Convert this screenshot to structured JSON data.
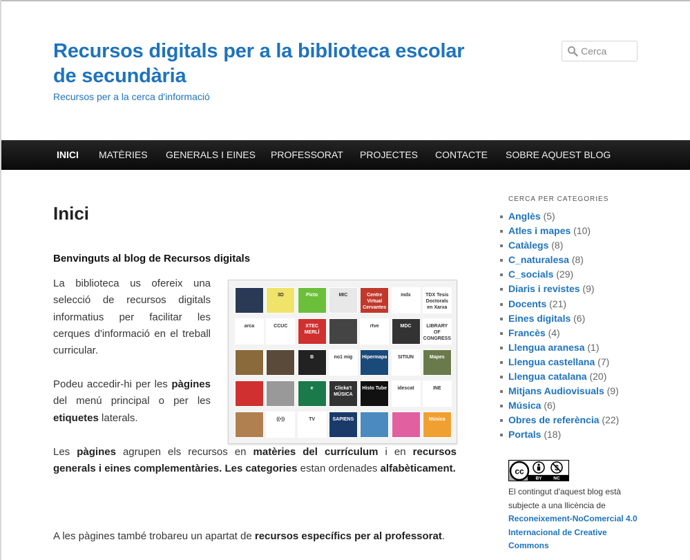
{
  "header": {
    "title": "Recursos digitals per a la biblioteca escolar de secundària",
    "tagline": "Recursos per a la cerca d'informació"
  },
  "search": {
    "placeholder": "Cerca",
    "icon": "search-icon"
  },
  "nav": [
    {
      "label": "INICI",
      "active": true
    },
    {
      "label": "MATÈRIES"
    },
    {
      "label": "GENERALS I EINES"
    },
    {
      "label": "PROFESSORAT"
    },
    {
      "label": "PROJECTES"
    },
    {
      "label": "CONTACTE"
    },
    {
      "label": "SOBRE AQUEST BLOG"
    }
  ],
  "page": {
    "title": "Inici",
    "welcome": "Benvinguts al blog de Recursos digitals",
    "p1": "La biblioteca us ofereix una selecció de recursos digitals informatius per facilitar les cerques d'informació en el treball curricular.",
    "p2_a": "Podeu accedir-hi per les ",
    "p2_b": "pàgines",
    "p2_c": " del menú principal o per les ",
    "p2_d": "etiquetes",
    "p2_e": " laterals.",
    "p3_a": "Les ",
    "p3_b": "pàgines",
    "p3_c": " agrupen els recursos en ",
    "p3_d": "matèries del currículum",
    "p3_e": " i en ",
    "p3_f": "recursos generals i eines complementàries. Les categories",
    "p3_g": " estan ordenades ",
    "p3_h": "alfabèticament.",
    "p4_a": "A les pàgines també trobareu un apartat de ",
    "p4_b": "recursos específics per al professorat",
    "p4_c": "."
  },
  "mosaic": {
    "tiles": [
      {
        "text": "",
        "bg": "#2a3a55"
      },
      {
        "text": "3D",
        "bg": "#f0e36a"
      },
      {
        "text": "Picto",
        "bg": "#6cbf3a"
      },
      {
        "text": "MIC",
        "bg": "#e8e8e8"
      },
      {
        "text": "Centre Virtual Cervantes",
        "bg": "#c0392b"
      },
      {
        "text": "mdx",
        "bg": "#ffffff"
      },
      {
        "text": "TDX Tesis Doctorals en Xarxa",
        "bg": "#ffffff"
      },
      {
        "text": "arca",
        "bg": "#ffffff"
      },
      {
        "text": "CCUC",
        "bg": "#ffffff"
      },
      {
        "text": "XTEC MERLÍ",
        "bg": "#d03030"
      },
      {
        "text": "",
        "bg": "#444444"
      },
      {
        "text": "rtve",
        "bg": "#ffffff"
      },
      {
        "text": "MDC",
        "bg": "#333333"
      },
      {
        "text": "LIBRARY OF CONGRESS",
        "bg": "#ffffff"
      },
      {
        "text": "",
        "bg": "#8a6a3a"
      },
      {
        "text": "",
        "bg": "#5a4a3a"
      },
      {
        "text": "B",
        "bg": "#222222"
      },
      {
        "text": "no1 mig",
        "bg": "#ffffff"
      },
      {
        "text": "Hipermapa",
        "bg": "#1a4a7a"
      },
      {
        "text": "SITIUN",
        "bg": "#ffffff"
      },
      {
        "text": "Mapes",
        "bg": "#6a7a4a"
      },
      {
        "text": "",
        "bg": "#d03030"
      },
      {
        "text": "",
        "bg": "#999999"
      },
      {
        "text": "e",
        "bg": "#1a7a4a"
      },
      {
        "text": "Clicka't MÚSICA",
        "bg": "#333333"
      },
      {
        "text": "Histo Tube",
        "bg": "#111111"
      },
      {
        "text": "idescat",
        "bg": "#ffffff"
      },
      {
        "text": "INE",
        "bg": "#ffffff"
      },
      {
        "text": "",
        "bg": "#b08050"
      },
      {
        "text": "((•))",
        "bg": "#ffffff"
      },
      {
        "text": "TV",
        "bg": "#ffffff"
      },
      {
        "text": "SAPIENS",
        "bg": "#1a3a6a"
      },
      {
        "text": "",
        "bg": "#4a8ac0"
      },
      {
        "text": "",
        "bg": "#e060a0"
      },
      {
        "text": "Música",
        "bg": "#f0a030"
      }
    ]
  },
  "sidebar": {
    "title": "CERCA PER CATEGORIES",
    "categories": [
      {
        "name": "Anglès",
        "count": "(5)"
      },
      {
        "name": "Atles i mapes",
        "count": "(10)"
      },
      {
        "name": "Catàlegs",
        "count": "(8)"
      },
      {
        "name": "C_naturalesa",
        "count": "(8)"
      },
      {
        "name": "C_socials",
        "count": "(29)"
      },
      {
        "name": "Diaris i revistes",
        "count": "(9)"
      },
      {
        "name": "Docents",
        "count": "(21)"
      },
      {
        "name": "Eines digitals",
        "count": "(6)"
      },
      {
        "name": "Francès",
        "count": "(4)"
      },
      {
        "name": "Llengua aranesa",
        "count": "(1)"
      },
      {
        "name": "Llengua castellana",
        "count": "(7)"
      },
      {
        "name": "Llengua catalana",
        "count": "(20)"
      },
      {
        "name": "Mitjans Audiovisuals",
        "count": "(9)"
      },
      {
        "name": "Música",
        "count": "(6)"
      },
      {
        "name": "Obres de referència",
        "count": "(22)"
      },
      {
        "name": "Portals",
        "count": "(18)"
      }
    ],
    "cc_badge": {
      "cc": "cc",
      "by": "BY",
      "nc": "NC"
    },
    "license_text": "El contingut d'aquest blog està subjecte a una llicència de ",
    "license_link": "Reconeixement-NoComercial 4.0 Internacional de Creative Commons"
  }
}
